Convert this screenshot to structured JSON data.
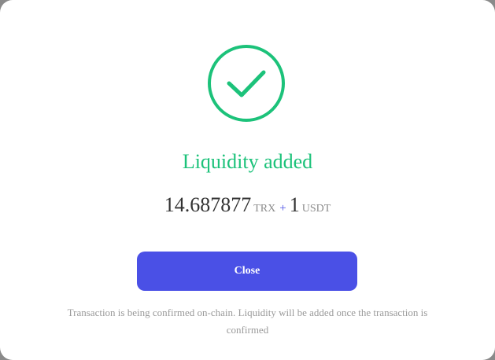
{
  "dialog": {
    "title": "Liquidity added",
    "amount_a": "14.687877",
    "token_a": "TRX",
    "plus": "+",
    "amount_b": "1",
    "token_b": "USDT",
    "close_label": "Close",
    "note": "Transaction is being confirmed on-chain. Liquidity will be added once the transaction is confirmed"
  },
  "icons": {
    "success": "check-circle-icon"
  },
  "colors": {
    "success": "#1cc27a",
    "accent": "#4a50e6",
    "muted": "#9a9a9a",
    "amount": "#333333"
  }
}
